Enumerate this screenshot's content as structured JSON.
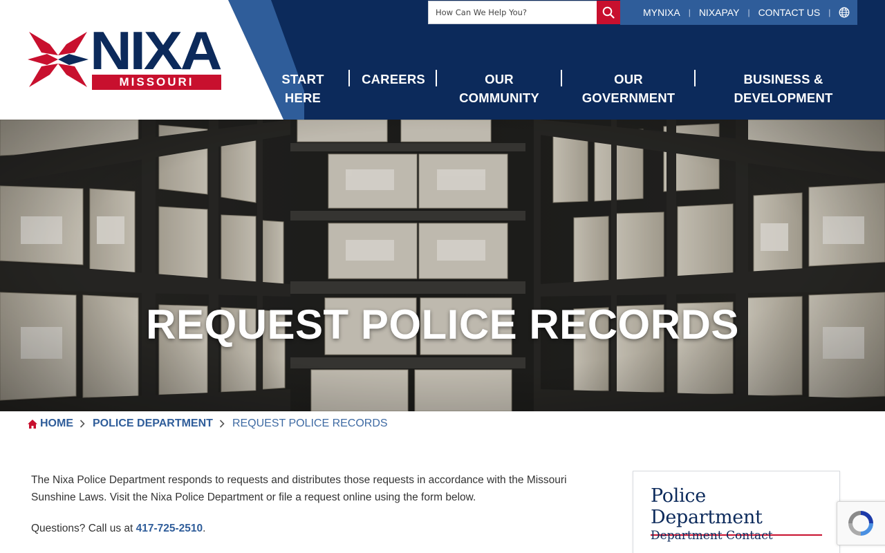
{
  "logo": {
    "word": "NIXA",
    "subtitle": "MISSOURI"
  },
  "search": {
    "placeholder": "How Can We Help You?",
    "icon": "search-icon"
  },
  "utility_links": [
    "MYNIXA",
    "NIXAPAY",
    "CONTACT US"
  ],
  "utility_icon": "globe-icon",
  "nav": [
    {
      "line1": "START",
      "line2": "HERE"
    },
    {
      "line1": "CAREERS",
      "line2": ""
    },
    {
      "line1": "OUR",
      "line2": "COMMUNITY"
    },
    {
      "line1": "OUR",
      "line2": "GOVERNMENT"
    },
    {
      "line1": "BUSINESS &",
      "line2": "DEVELOPMENT"
    }
  ],
  "hero": {
    "title": "REQUEST POLICE RECORDS"
  },
  "breadcrumb": {
    "home": "HOME",
    "parent": "POLICE DEPARTMENT",
    "current": "REQUEST POLICE RECORDS"
  },
  "content": {
    "paragraph1": "The Nixa Police Department responds to requests and distributes those requests in accordance with the Missouri Sunshine Laws. Visit the Nixa Police Department or file a request online using the form below.",
    "questions_prefix": "Questions? Call us at ",
    "phone": "417-725-2510",
    "questions_suffix": "."
  },
  "sidebar": {
    "title": "Police Department",
    "links": [
      "Department Contact"
    ]
  },
  "colors": {
    "navy": "#0c2a5b",
    "mid_blue": "#2f5d9a",
    "red": "#c8102e"
  }
}
